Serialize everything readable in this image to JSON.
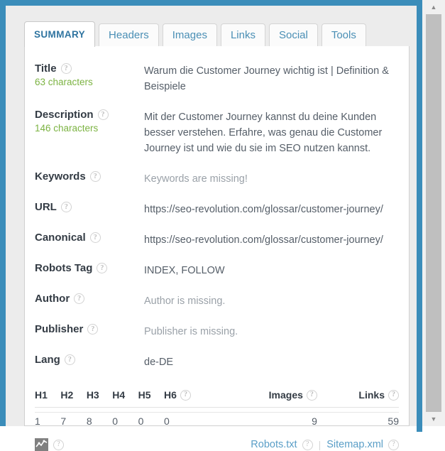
{
  "theme": {
    "frame_blue": "#3b8dba",
    "page_bg": "#ececec",
    "panel_bg": "#ffffff",
    "link_blue": "#5a9ec7",
    "active_tab_blue": "#2f74a0",
    "count_green": "#7cb342",
    "muted_gray": "#9aa1a8"
  },
  "tabs": [
    {
      "label": "SUMMARY",
      "active": true
    },
    {
      "label": "Headers",
      "active": false
    },
    {
      "label": "Images",
      "active": false
    },
    {
      "label": "Links",
      "active": false
    },
    {
      "label": "Social",
      "active": false
    },
    {
      "label": "Tools",
      "active": false
    }
  ],
  "help_icon": "?",
  "summary": {
    "rows": [
      {
        "label": "Title",
        "count": "63 characters",
        "value": "Warum die Customer Journey wichtig ist | Definition & Beispiele",
        "muted": false
      },
      {
        "label": "Description",
        "count": "146 characters",
        "value": "Mit der Customer Journey kannst du deine Kunden besser verstehen. Erfahre, was genau die Customer Journey ist und wie du sie im SEO nutzen kannst.",
        "muted": false
      },
      {
        "label": "Keywords",
        "count": "",
        "value": "Keywords are missing!",
        "muted": true
      },
      {
        "label": "URL",
        "count": "",
        "value": "https://seo-revolution.com/glossar/customer-journey/",
        "muted": false
      },
      {
        "label": "Canonical",
        "count": "",
        "value": "https://seo-revolution.com/glossar/customer-journey/",
        "muted": false
      },
      {
        "label": "Robots Tag",
        "count": "",
        "value": "INDEX, FOLLOW",
        "muted": false
      },
      {
        "label": "Author",
        "count": "",
        "value": "Author is missing.",
        "muted": true
      },
      {
        "label": "Publisher",
        "count": "",
        "value": "Publisher is missing.",
        "muted": true
      },
      {
        "label": "Lang",
        "count": "",
        "value": "de-DE",
        "muted": false
      }
    ]
  },
  "counts_table": {
    "columns": [
      {
        "key": "h1",
        "label": "H1",
        "help": false,
        "align": "left"
      },
      {
        "key": "h2",
        "label": "H2",
        "help": false,
        "align": "left"
      },
      {
        "key": "h3",
        "label": "H3",
        "help": false,
        "align": "left"
      },
      {
        "key": "h4",
        "label": "H4",
        "help": false,
        "align": "left"
      },
      {
        "key": "h5",
        "label": "H5",
        "help": false,
        "align": "left"
      },
      {
        "key": "h6",
        "label": "H6",
        "help": true,
        "align": "left"
      },
      {
        "key": "images",
        "label": "Images",
        "help": true,
        "align": "right"
      },
      {
        "key": "links",
        "label": "Links",
        "help": true,
        "align": "right"
      }
    ],
    "values": {
      "h1": "1",
      "h2": "7",
      "h3": "8",
      "h4": "0",
      "h5": "0",
      "h6": "0",
      "images": "9",
      "links": "59"
    }
  },
  "footer": {
    "chart_icon_name": "line-chart-icon",
    "robots_link": "Robots.txt",
    "separator": "|",
    "sitemap_link": "Sitemap.xml"
  },
  "scrollbar": {
    "up_arrow": "▲",
    "down_arrow": "▼"
  }
}
